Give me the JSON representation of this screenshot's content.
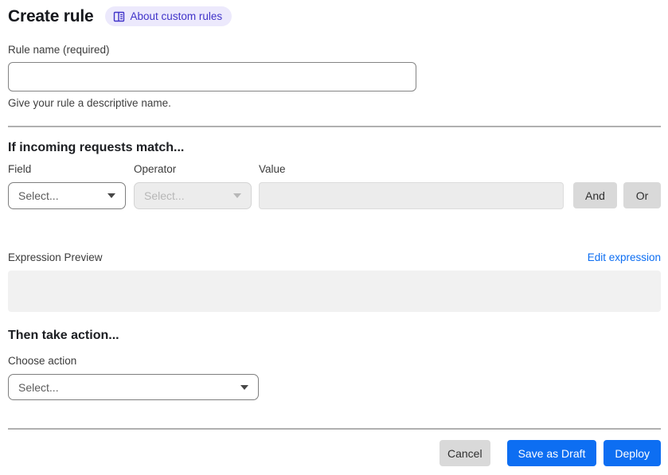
{
  "header": {
    "title": "Create rule",
    "badge_label": "About custom rules"
  },
  "rule_name": {
    "label": "Rule name (required)",
    "value": "",
    "helper": "Give your rule a descriptive name."
  },
  "match_section": {
    "heading": "If incoming requests match...",
    "field": {
      "label": "Field",
      "placeholder": "Select..."
    },
    "operator": {
      "label": "Operator",
      "placeholder": "Select..."
    },
    "value": {
      "label": "Value",
      "value": ""
    },
    "and_label": "And",
    "or_label": "Or"
  },
  "expression_section": {
    "label": "Expression Preview",
    "edit_link": "Edit expression",
    "content": ""
  },
  "action_section": {
    "heading": "Then take action...",
    "choose_label": "Choose action",
    "placeholder": "Select..."
  },
  "footer": {
    "cancel": "Cancel",
    "save_draft": "Save as Draft",
    "deploy": "Deploy"
  },
  "icons": {
    "badge": "book-icon",
    "selects": "chevron-down-icon"
  },
  "colors": {
    "accent_blue": "#0d6ef2",
    "badge_bg": "#ece9fc",
    "badge_text": "#4134c9",
    "gray_button_bg": "#d9d9d9",
    "disabled_bg": "#ececec",
    "preview_bg": "#f1f1f1",
    "divider": "#b0b0b0"
  }
}
